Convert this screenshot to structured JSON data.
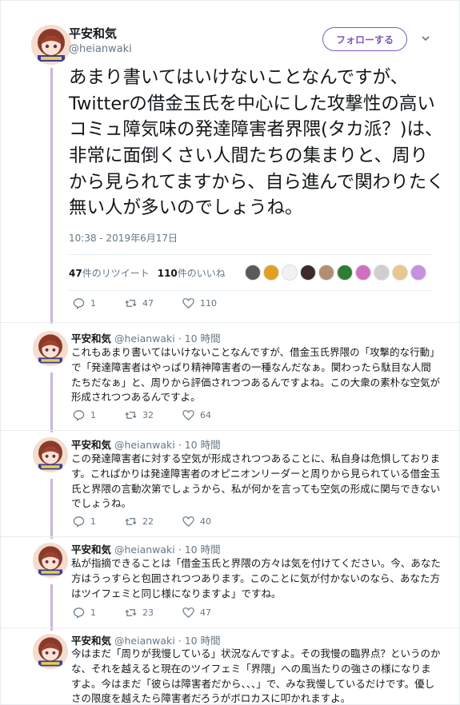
{
  "main": {
    "name": "平安和気",
    "handle": "@heianwaki",
    "follow_label": "フォローする",
    "text": "あまり書いてはいけないことなんですが、Twitterの借金玉氏を中心にした攻撃性の高いコミュ障気味の発達障害者界隈(タカ派？)は、非常に面倒くさい人間たちの集まりと、周りから見られてますから、自ら進んで関わりたく無い人が多いのでしょうね。",
    "timestamp": "10:38 - 2019年6月17日",
    "retweet_count": "47",
    "retweet_label": "件のリツイート",
    "like_count": "110",
    "like_label": "件のいいね",
    "actions": {
      "reply": "1",
      "retweet": "47",
      "like": "110"
    }
  },
  "likers": [
    {
      "icon": "liker-avatar-1",
      "color": "#5a5a5a"
    },
    {
      "icon": "liker-avatar-2",
      "color": "#e0a020"
    },
    {
      "icon": "liker-avatar-3",
      "color": "#f2f2f2"
    },
    {
      "icon": "liker-avatar-4",
      "color": "#3a2a2a"
    },
    {
      "icon": "liker-avatar-5",
      "color": "#b09070"
    },
    {
      "icon": "liker-avatar-6",
      "color": "#2e7d32"
    },
    {
      "icon": "liker-avatar-7",
      "color": "#d070c0"
    },
    {
      "icon": "liker-avatar-8",
      "color": "#cfcfcf"
    },
    {
      "icon": "liker-avatar-9",
      "color": "#e8c890"
    },
    {
      "icon": "liker-avatar-10",
      "color": "#c890e0"
    }
  ],
  "replies": [
    {
      "name": "平安和気",
      "handle": "@heianwaki",
      "time": "10 時間",
      "text": "これもあまり書いてはいけないことなんですが、借金玉氏界隈の「攻撃的な行動」で「発達障害者はやっぱり精神障害者の一種なんだなぁ。関わったら駄目な人間たちだなぁ」と、周りから評価されつつあるんですよね。この大衆の素朴な空気が形成されつつあるんですよ。",
      "actions": {
        "reply": "1",
        "retweet": "32",
        "like": "64"
      }
    },
    {
      "name": "平安和気",
      "handle": "@heianwaki",
      "time": "10 時間",
      "text": "この発達障害者に対する空気が形成されつつあることに、私自身は危惧しております。これぱかりは発達障害者のオピニオンリーダーと周りから見られている借金玉氏と界隈の言動次第でしょうから、私が何かを言っても空気の形成に関与できないでしょうね。",
      "actions": {
        "reply": "1",
        "retweet": "22",
        "like": "40"
      }
    },
    {
      "name": "平安和気",
      "handle": "@heianwaki",
      "time": "10 時間",
      "text": "私が指摘できることは「借金玉氏と界隈の方々は気を付けてください。今、あなた方はうっすらと包囲されつつあります。このことに気が付かないのなら、あなた方はツイフェミと同じ様になりますよ」ですね。",
      "actions": {
        "reply": "1",
        "retweet": "23",
        "like": "47"
      }
    },
    {
      "name": "平安和気",
      "handle": "@heianwaki",
      "time": "10 時間",
      "text": "今はまだ「周りが我慢している」状況なんですよ。その我慢の臨界点？というのかな、それを越えると現在のツイフェミ「界隈」への風当たりの強さの様になりますよ。今はまだ「彼らは障害者だから、、、」で、みな我慢しているだけです。優しさの限度を越えたら障害者だろうがボロカスに叩かれますよ。",
      "actions": {
        "reply": "",
        "retweet": "",
        "like": ""
      }
    }
  ]
}
